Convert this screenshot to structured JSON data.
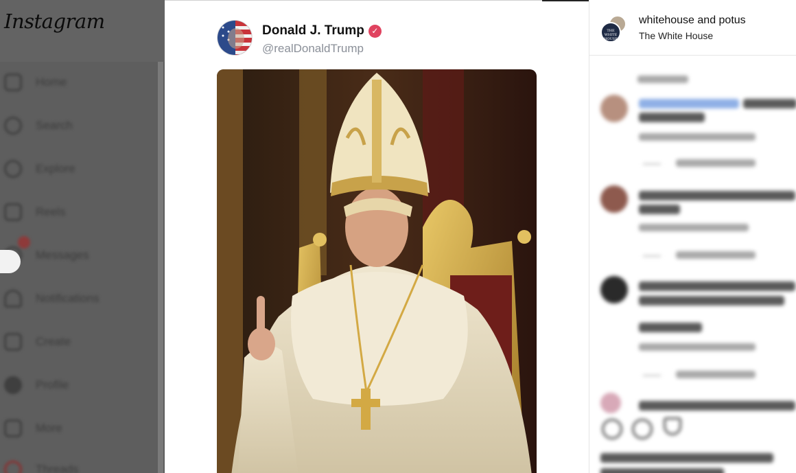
{
  "app": {
    "logo_text": "Instagram"
  },
  "sidebar": {
    "items": [
      {
        "label": "Home",
        "icon": "home-icon"
      },
      {
        "label": "Search",
        "icon": "search-icon"
      },
      {
        "label": "Explore",
        "icon": "explore-icon"
      },
      {
        "label": "Reels",
        "icon": "reels-icon"
      },
      {
        "label": "Messages",
        "icon": "messages-icon"
      },
      {
        "label": "Notifications",
        "icon": "heart-icon"
      },
      {
        "label": "Create",
        "icon": "create-icon"
      },
      {
        "label": "Profile",
        "icon": "profile-icon"
      },
      {
        "label": "More",
        "icon": "menu-icon"
      },
      {
        "label": "Threads",
        "icon": "threads-icon"
      }
    ]
  },
  "post": {
    "author_name": "Donald J. Trump",
    "author_handle": "@realDonaldTrump",
    "verified_icon": "verified-badge-icon",
    "verified_color": "#e0435f"
  },
  "panel": {
    "title": "whitehouse and potus",
    "subtitle": "The White House",
    "avatar_text": "THE WHITE HOUSE"
  }
}
